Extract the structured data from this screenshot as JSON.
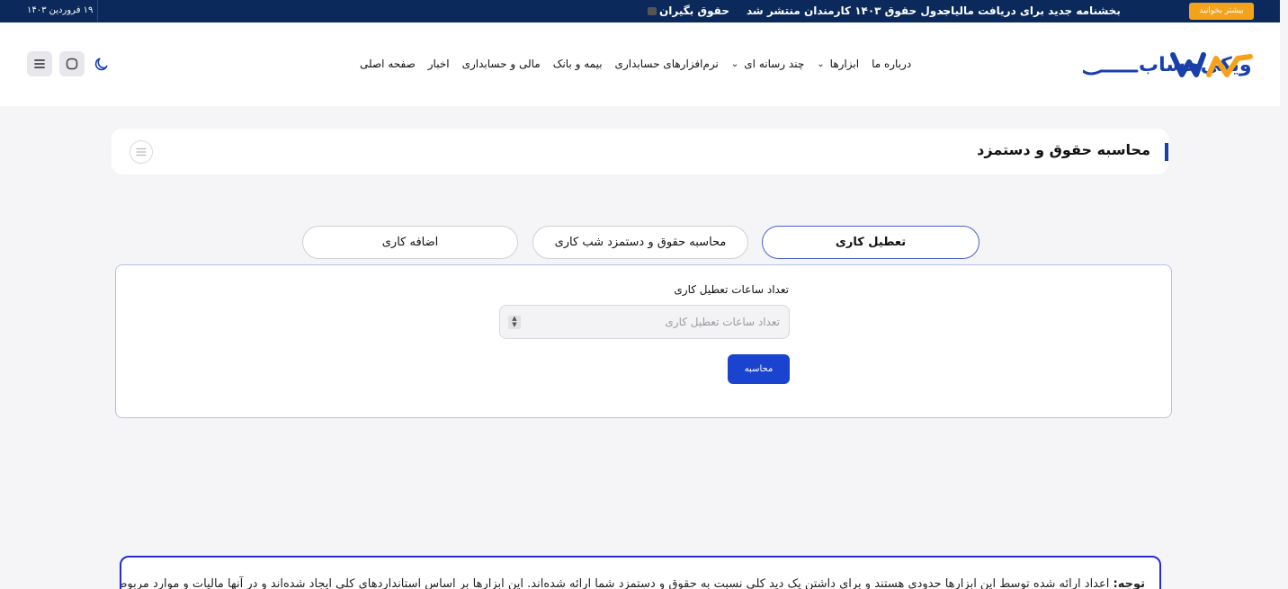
{
  "topbar": {
    "date": "۱۹ فروردین ۱۴۰۳",
    "more_button": "بیشتر بخوانید",
    "news": [
      "بخشنامه جدید برای دریافت مالیات",
      "جدول حقوق ۱۴۰۳ کارمندان منتشر شد",
      "حقوق بگیران"
    ]
  },
  "header": {
    "logo_text": "ویکی‌حساب",
    "nav": [
      {
        "label": "صفحه اصلی",
        "dropdown": false
      },
      {
        "label": "اخبار",
        "dropdown": false
      },
      {
        "label": "مالی و حسابداری",
        "dropdown": false
      },
      {
        "label": "بیمه و بانک",
        "dropdown": false
      },
      {
        "label": "نرم‌افزارهای حسابداری",
        "dropdown": false
      },
      {
        "label": "چند رسانه ای",
        "dropdown": true
      },
      {
        "label": "ابزارها",
        "dropdown": true
      },
      {
        "label": "درباره ما",
        "dropdown": false
      }
    ]
  },
  "page": {
    "title": "محاسبه حقوق و دستمزد"
  },
  "tabs": [
    {
      "label": "تعطیل کاری",
      "active": true
    },
    {
      "label": "محاسبه حقوق و دستمزد شب کاری",
      "active": false
    },
    {
      "label": "اضافه کاری",
      "active": false
    }
  ],
  "form": {
    "label": "تعداد ساعات تعطیل کاری",
    "input_placeholder": "تعداد ساعات تعطیل کاری",
    "input_value": "",
    "submit": "محاسبه"
  },
  "notice": {
    "prefix": "توجه:",
    "text": "اعداد ارائه شده توسط این ابزارها حدودی هستند و برای داشتن یک دید کلی نسبت به حقوق و دستمزد شما ارائه شده‌اند. این ابزارها بر اساس استانداردهای کلی ایجاد شده‌اند و در آنها مالیات و موارد مربوط به"
  },
  "colors": {
    "topbar_bg": "#0b2a5b",
    "accent_orange": "#f5a21b",
    "primary_blue": "#1a44d0",
    "title_bar": "#1840a8"
  }
}
